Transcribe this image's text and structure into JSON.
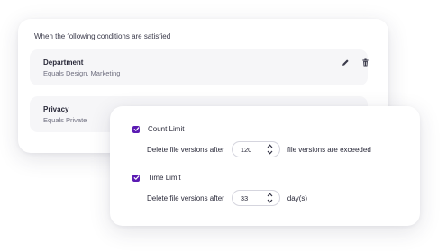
{
  "conditions_card": {
    "heading": "When the following conditions are satisfied",
    "rows": [
      {
        "title": "Department",
        "subtitle": "Equals Design, Marketing",
        "icons": [
          "pencil-icon",
          "trash-icon"
        ]
      },
      {
        "title": "Privacy",
        "subtitle": "Equals Private"
      }
    ]
  },
  "limits_card": {
    "count_limit": {
      "label": "Count Limit",
      "checked": true,
      "prefix": "Delete file versions after",
      "value": "120",
      "suffix": "file versions are exceeded"
    },
    "time_limit": {
      "label": "Time Limit",
      "checked": true,
      "prefix": "Delete file versions after",
      "value": "33",
      "suffix": "day(s)"
    }
  },
  "colors": {
    "accent": "#5b1bb3",
    "row_background": "#f6f6f8",
    "text": "#2a2a3a",
    "muted_text": "#707080"
  }
}
